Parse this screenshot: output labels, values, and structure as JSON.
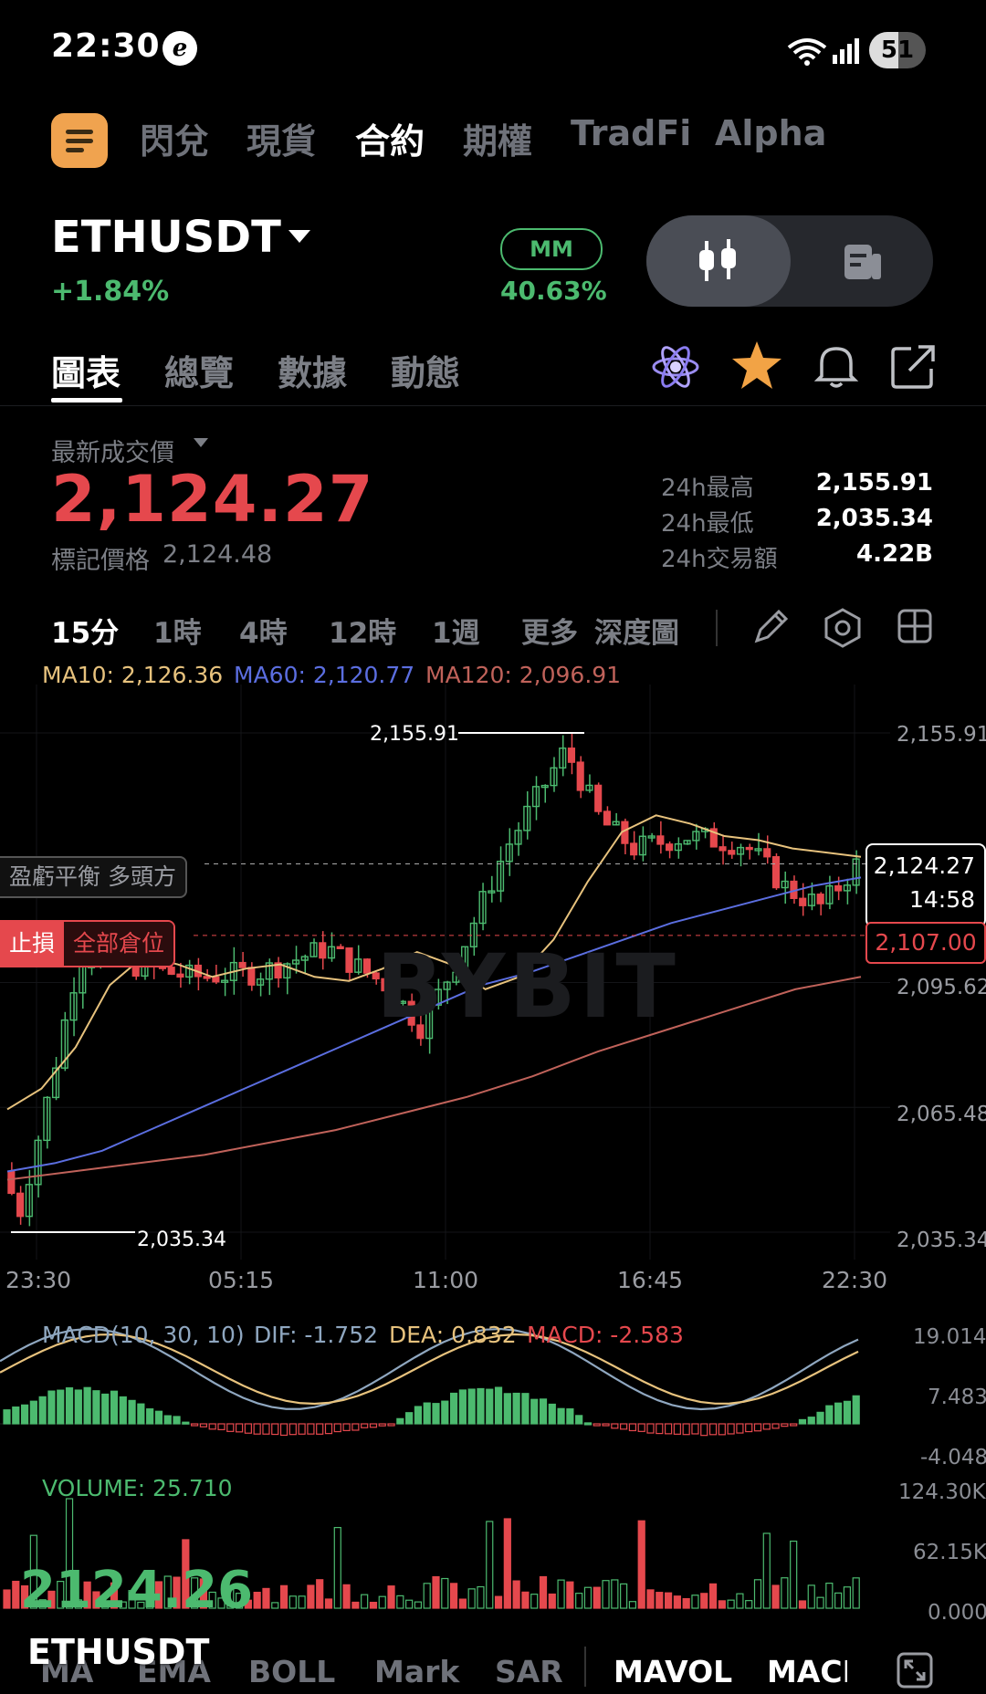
{
  "status_bar": {
    "time": "22:30",
    "notif_glyph": "e",
    "battery": "51"
  },
  "top_nav": {
    "tabs": [
      "閃兌",
      "現貨",
      "合約",
      "期權",
      "TradFi",
      "Alpha"
    ],
    "active_index": 2
  },
  "pair": {
    "symbol": "ETHUSDT",
    "change": "+1.84%",
    "mm_label": "MM",
    "mm_value": "40.63%"
  },
  "sub_tabs": {
    "tabs": [
      "圖表",
      "總覽",
      "數據",
      "動態"
    ],
    "active_index": 0
  },
  "price": {
    "label": "最新成交價",
    "last": "2,124.27",
    "mark_label": "標記價格",
    "mark_value": "2,124.48",
    "stats": [
      {
        "label": "24h最高",
        "value": "2,155.91"
      },
      {
        "label": "24h最低",
        "value": "2,035.34"
      },
      {
        "label": "24h交易額",
        "value": "4.22B"
      }
    ]
  },
  "intervals": {
    "items": [
      "15分",
      "1時",
      "4時",
      "12時",
      "1週",
      "更多"
    ],
    "depth_label": "深度圖",
    "active_index": 0
  },
  "ma_legend": {
    "ma10": "MA10: 2,126.36",
    "ma60": "MA60: 2,120.77",
    "ma120": "MA120: 2,096.91"
  },
  "chart_data": {
    "type": "candlestick",
    "price_axis_ticks": [
      "2,155.91",
      "2,095.62",
      "2,065.48",
      "2,035.34"
    ],
    "time_axis_ticks": [
      "23:30",
      "05:15",
      "11:00",
      "16:45",
      "22:30"
    ],
    "high_marker": "2,155.91",
    "low_marker": "2,035.34",
    "ylim": [
      2035.34,
      2155.91
    ],
    "current_price": "2,124.27",
    "countdown": "14:58",
    "stop_price": "2,107.00",
    "position_label": "盈虧平衡 多頭方",
    "stop_label": "止損",
    "stop_sub_label": "全部倉位",
    "watermark": "BYBIT",
    "colors": {
      "up": "#4cba6f",
      "down": "#e5484d",
      "ma10": "#e7c27d",
      "ma60": "#5b6ee0",
      "ma120": "#c0625a"
    },
    "ma10_anchor_values": [
      2065,
      2070,
      2080,
      2095,
      2102,
      2100,
      2097,
      2099,
      2100,
      2097,
      2096,
      2099,
      2103,
      2100,
      2094,
      2097,
      2106,
      2120,
      2132,
      2136,
      2134,
      2131,
      2130,
      2128,
      2127,
      2126
    ],
    "ma60_anchor_values": [
      2050,
      2052,
      2055,
      2060,
      2065,
      2070,
      2075,
      2080,
      2085,
      2090,
      2095,
      2098,
      2102,
      2106,
      2110,
      2113,
      2116,
      2119,
      2121
    ],
    "ma120_anchor_values": [
      2048,
      2050,
      2052,
      2054,
      2057,
      2060,
      2064,
      2068,
      2073,
      2079,
      2084,
      2089,
      2094,
      2097
    ]
  },
  "macd": {
    "label": "MACD(10, 30, 10)",
    "dif": "DIF: -1.752",
    "dea": "DEA: 0.832",
    "macd": "MACD: -2.583",
    "ticks": [
      "19.014",
      "7.483",
      "-4.048"
    ]
  },
  "volume": {
    "label": "VOLUME: 25.710",
    "ticks": [
      "124.30K",
      "62.15K",
      "0.000"
    ]
  },
  "overlay": {
    "big_price": "2124.26",
    "symbol": "ETHUSDT"
  },
  "bottom_tabs": {
    "items": [
      "MA",
      "EMA",
      "BOLL",
      "Mark",
      "SAR",
      "MAVOL",
      "MACD"
    ],
    "active": [
      "MAVOL",
      "MACD"
    ]
  }
}
